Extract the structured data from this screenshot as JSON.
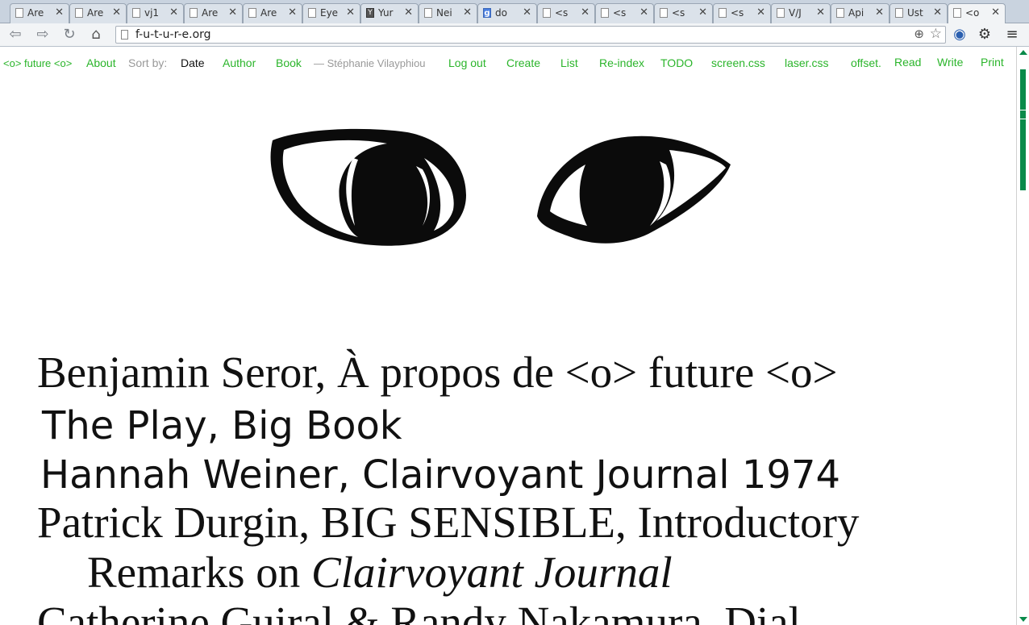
{
  "browser": {
    "tabs": [
      {
        "label": "Are",
        "icon": "page-icon",
        "close": "✕"
      },
      {
        "label": "Are",
        "icon": "page-icon",
        "close": "✕"
      },
      {
        "label": "vj1",
        "icon": "page-icon",
        "close": "✕"
      },
      {
        "label": "Are",
        "icon": "page-icon",
        "close": "✕"
      },
      {
        "label": "Are",
        "icon": "page-icon",
        "close": "✕"
      },
      {
        "label": "Eye",
        "icon": "page-icon",
        "close": "✕"
      },
      {
        "label": "Yur",
        "icon": "ycombinator-icon",
        "close": "✕"
      },
      {
        "label": "Nei",
        "icon": "page-icon",
        "close": "✕"
      },
      {
        "label": "do",
        "icon": "google-icon",
        "close": "✕"
      },
      {
        "label": "<s",
        "icon": "page-icon",
        "close": "✕"
      },
      {
        "label": "<s",
        "icon": "page-icon",
        "close": "✕"
      },
      {
        "label": "<s",
        "icon": "page-icon",
        "close": "✕"
      },
      {
        "label": "<s",
        "icon": "page-icon",
        "close": "✕"
      },
      {
        "label": "V/J",
        "icon": "page-icon",
        "close": "✕"
      },
      {
        "label": "Api",
        "icon": "page-icon",
        "close": "✕"
      },
      {
        "label": "Ust",
        "icon": "page-icon",
        "close": "✕"
      },
      {
        "label": "<o",
        "icon": "page-icon",
        "close": "✕",
        "active": true
      }
    ],
    "url": "f-u-t-u-r-e.org",
    "icons": {
      "back": "back-icon",
      "forward": "forward-icon",
      "reload": "reload-icon",
      "home": "home-icon",
      "zoom": "zoom-icon",
      "bookmark": "star-icon",
      "globe": "globe-icon",
      "settings": "gear-icon",
      "menu": "menu-icon"
    }
  },
  "nav": {
    "site": "<o> future <o>",
    "about": "About",
    "sort_by": "Sort by:",
    "date": "Date",
    "author": "Author",
    "book": "Book",
    "user": "— Stéphanie Vilayphiou",
    "logout": "Log out",
    "create": "Create",
    "list": "List",
    "reindex": "Re-index",
    "todo": "TODO",
    "screen_css": "screen.css",
    "laser_css": "laser.css",
    "offset": "offset.",
    "read": "Read",
    "write": "Write",
    "print": "Print"
  },
  "books": [
    {
      "text": "Benjamin Seror, À propos de <o> future <o>"
    },
    {
      "text": "The Play, Big Book"
    },
    {
      "text": "Hannah Weiner, Clairvoyant Journal 1974"
    },
    {
      "text": "Patrick Durgin, BIG SENSIBLE, Introductory"
    },
    {
      "text": "Remarks on ",
      "italic": "Clairvoyant Journal"
    },
    {
      "text": "Catherine Guiral & Randy Nakamura, Dial"
    }
  ],
  "colors": {
    "link": "#2bb52b",
    "scrollbar": "#0a8a4a",
    "text": "#111111"
  }
}
